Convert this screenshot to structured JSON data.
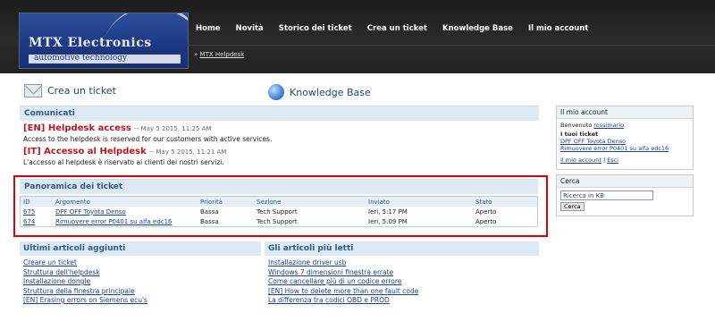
{
  "brand": {
    "name": "MTX Electronics",
    "tagline": "automotive technology"
  },
  "nav": {
    "items": [
      "Home",
      "Novità",
      "Storico dei ticket",
      "Crea un ticket",
      "Knowledge Base",
      "Il mio account"
    ]
  },
  "breadcrumb": {
    "prefix": "»",
    "link": "MTX Helpdesk"
  },
  "actions": {
    "create_ticket": "Crea un ticket",
    "knowledge_base": "Knowledge Base"
  },
  "announcements": {
    "title": "Comunicati",
    "items": [
      {
        "title": "[EN] Helpdesk access",
        "date": "-- May 5 2015, 11:25 AM",
        "body": "Access to the helpdesk is reserved for our customers with active services."
      },
      {
        "title": "[IT] Accesso al Helpdesk",
        "date": "-- May 5 2015, 11:21 AM",
        "body": "L'accesso al helpdesk è riservato ai clienti dei nostri servizi."
      }
    ]
  },
  "tickets": {
    "title": "Panoramica dei ticket",
    "columns": [
      "ID",
      "Argomento",
      "Priorità",
      "Sezione",
      "Inviato",
      "Stato"
    ],
    "rows": [
      {
        "id": "675",
        "subject": "DPF OFF Toyota Denso",
        "priority": "Bassa",
        "section": "Tech Support",
        "sent": "Ieri, 5:17 PM",
        "status": "Aperto"
      },
      {
        "id": "674",
        "subject": "Rimuovere error P0401 su alfa edc16",
        "priority": "Bassa",
        "section": "Tech Support",
        "sent": "Ieri, 5:09 PM",
        "status": "Aperto"
      }
    ]
  },
  "latest_articles": {
    "title": "Ultimi articoli aggiunti",
    "items": [
      "Creare un ticket",
      "Struttura dell'helpdesk",
      "Installazione dongle",
      "Struttura della finestra principale",
      "[EN] Erasing errors on Siemens ecu's"
    ]
  },
  "popular_articles": {
    "title": "Gli articoli più letti",
    "items": [
      "Installazione driver usb",
      "Windows 7 dimensioni finestra errate",
      "Come cancellare più di un codice errore",
      "[EN] How to delete more than one fault code",
      "La differenza tra codici OBD e PROD"
    ]
  },
  "account": {
    "title": "Il mio account",
    "welcome": "Benvenuto",
    "username": "rossimario",
    "tickets_label": "I tuoi ticket",
    "tickets": [
      "DPF OFF Toyota Denso",
      "Rimuovere error P0401 su alfa edc16"
    ],
    "my_account_link": "Il mio account",
    "separator": "|",
    "logout_link": "Esci"
  },
  "search": {
    "title": "Cerca",
    "placeholder": "Ricerca in KB",
    "button": "Cerca"
  },
  "colors": {
    "accent": "#2a5d8a",
    "highlight": "#e00000",
    "announcement": "#c0141c"
  },
  "icons": [
    "envelope-icon",
    "globe-icon"
  ]
}
